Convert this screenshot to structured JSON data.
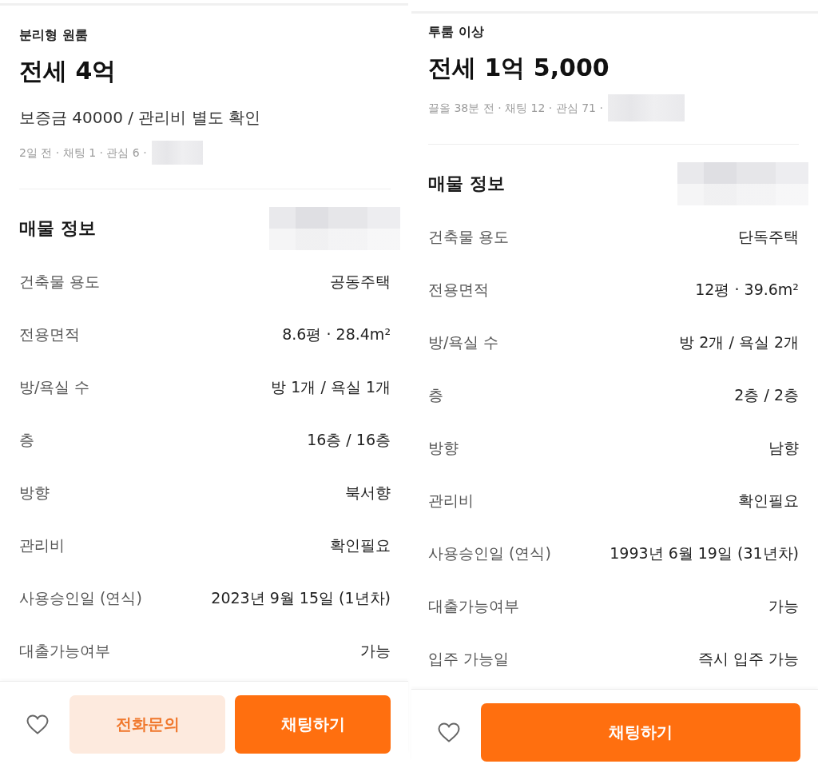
{
  "panels": [
    {
      "category": "분리형 원룸",
      "price": "전세 4억",
      "deposit": "보증금 40000 / 관리비 별도 확인",
      "meta": {
        "text": "2일 전 · 채팅 1 · 관심 6 ·",
        "redacted": true
      },
      "section": {
        "title": "매물 정보",
        "redacted": true
      },
      "details": [
        {
          "label": "건축물 용도",
          "value": "공동주택"
        },
        {
          "label": "전용면적",
          "value": "8.6평 · 28.4m²"
        },
        {
          "label": "방/욕실 수",
          "value": "방 1개 / 욕실 1개"
        },
        {
          "label": "층",
          "value": "16층 / 16층"
        },
        {
          "label": "방향",
          "value": "북서향"
        },
        {
          "label": "관리비",
          "value": "확인필요"
        },
        {
          "label": "사용승인일 (연식)",
          "value": "2023년 9월 15일 (1년차)"
        },
        {
          "label": "대출가능여부",
          "value": "가능"
        }
      ],
      "actions": {
        "liked": false,
        "buttons": [
          {
            "label": "전화문의",
            "kind": "secondary"
          },
          {
            "label": "채팅하기",
            "kind": "primary"
          }
        ]
      }
    },
    {
      "category": "투룸 이상",
      "price": "전세 1억 5,000",
      "meta": {
        "text": "끌올 38분 전 · 채팅 12 · 관심 71 ·",
        "redacted": true
      },
      "section": {
        "title": "매물 정보",
        "redacted": true
      },
      "details": [
        {
          "label": "건축물 용도",
          "value": "단독주택"
        },
        {
          "label": "전용면적",
          "value": "12평 · 39.6m²"
        },
        {
          "label": "방/욕실 수",
          "value": "방 2개 / 욕실 2개"
        },
        {
          "label": "층",
          "value": "2층 / 2층"
        },
        {
          "label": "방향",
          "value": "남향"
        },
        {
          "label": "관리비",
          "value": "확인필요"
        },
        {
          "label": "사용승인일 (연식)",
          "value": "1993년 6월 19일 (31년차)"
        },
        {
          "label": "대출가능여부",
          "value": "가능"
        },
        {
          "label": "입주 가능일",
          "value": "즉시 입주 가능"
        }
      ],
      "actions": {
        "liked": false,
        "buttons": [
          {
            "label": "채팅하기",
            "kind": "primary"
          }
        ]
      }
    }
  ]
}
